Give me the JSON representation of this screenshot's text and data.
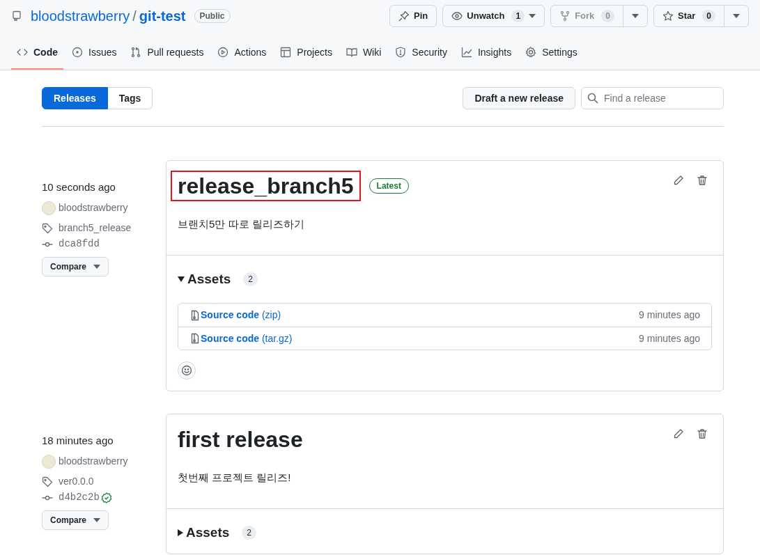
{
  "repo": {
    "owner": "bloodstrawberry",
    "separator": "/",
    "name": "git-test",
    "visibility": "Public"
  },
  "actions": [
    {
      "kind": "pin",
      "label": "Pin"
    },
    {
      "kind": "watch",
      "label": "Unwatch",
      "count": "1"
    },
    {
      "kind": "fork",
      "label": "Fork",
      "count": "0",
      "disabled": true
    },
    {
      "kind": "star",
      "label": "Star",
      "count": "0"
    }
  ],
  "tabs": [
    {
      "label": "Code",
      "selected": true
    },
    {
      "label": "Issues",
      "selected": false
    },
    {
      "label": "Pull requests",
      "selected": false
    },
    {
      "label": "Actions",
      "selected": false
    },
    {
      "label": "Projects",
      "selected": false
    },
    {
      "label": "Wiki",
      "selected": false
    },
    {
      "label": "Security",
      "selected": false
    },
    {
      "label": "Insights",
      "selected": false
    },
    {
      "label": "Settings",
      "selected": false
    }
  ],
  "subnav": [
    {
      "label": "Releases",
      "selected": true
    },
    {
      "label": "Tags",
      "selected": false
    }
  ],
  "draft_button": "Draft a new release",
  "search": {
    "placeholder": "Find a release"
  },
  "releases": [
    {
      "time": "10 seconds ago",
      "author": "bloodstrawberry",
      "tag": "branch5_release",
      "commit": "dca8fdd",
      "verified": false,
      "compare": "Compare",
      "title": "release_branch5",
      "highlighted": true,
      "badge": "Latest",
      "body": "브랜치5만 따로 릴리즈하기",
      "assets_label": "Assets",
      "assets_count": "2",
      "expanded": true,
      "assets": [
        {
          "name": "Source code",
          "ext": "(zip)",
          "time": "9 minutes ago"
        },
        {
          "name": "Source code",
          "ext": "(tar.gz)",
          "time": "9 minutes ago"
        }
      ]
    },
    {
      "time": "18 minutes ago",
      "author": "bloodstrawberry",
      "tag": "ver0.0.0",
      "commit": "d4b2c2b",
      "verified": true,
      "compare": "Compare",
      "title": "first release",
      "highlighted": false,
      "body": "첫번째 프로젝트 릴리즈!",
      "assets_label": "Assets",
      "assets_count": "2",
      "expanded": false
    }
  ]
}
